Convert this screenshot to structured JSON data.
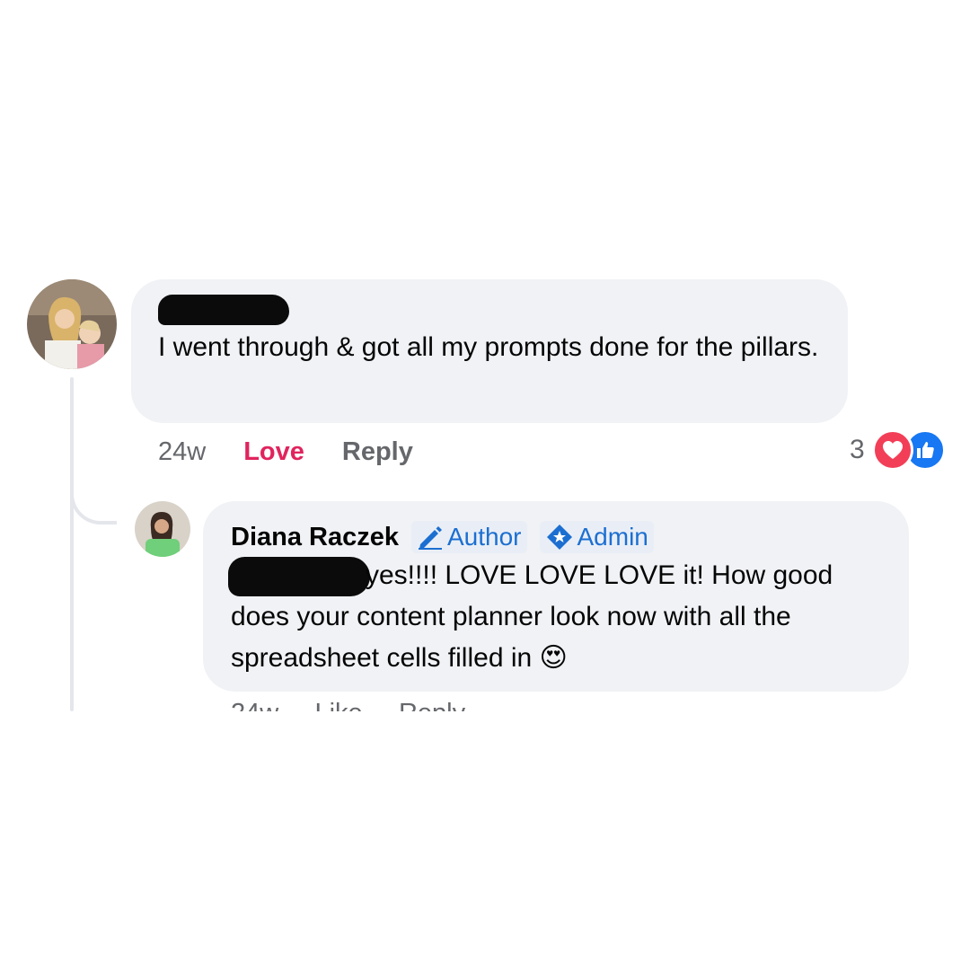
{
  "comment": {
    "text": "I went through & got all my prompts done for the pillars.",
    "time": "24w",
    "love_label": "Love",
    "reply_label": "Reply",
    "reaction_count": "3",
    "reactions": [
      "love-icon",
      "like-icon"
    ]
  },
  "reply": {
    "author": "Diana Raczek",
    "badge_author": "Author",
    "badge_admin": "Admin",
    "text": "yes!!!! LOVE LOVE LOVE it! How good does your content planner look now with all the spreadsheet cells filled in 😍"
  },
  "colors": {
    "bubble": "#f0f2f5",
    "love": "#e0245e",
    "badge": "#1c6fd1",
    "meta": "#65676b"
  }
}
